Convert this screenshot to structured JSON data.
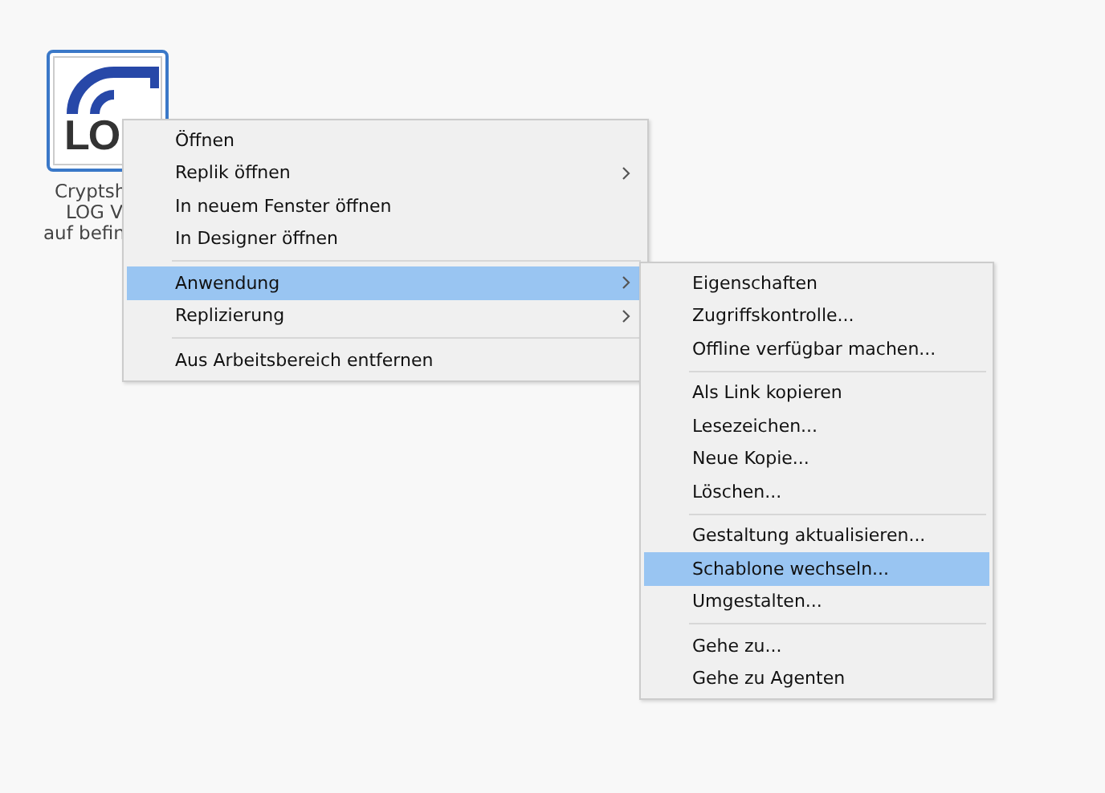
{
  "desktop_icon": {
    "logo_text": "LO",
    "selected": true,
    "label_lines": [
      "Cryptsh",
      "LOG V",
      "auf befin"
    ]
  },
  "context_menu": {
    "items": [
      {
        "kind": "item",
        "label": "Öffnen",
        "selected": false,
        "has_submenu": false
      },
      {
        "kind": "item",
        "label": "Replik öffnen",
        "selected": false,
        "has_submenu": true
      },
      {
        "kind": "item",
        "label": "In neuem Fenster öffnen",
        "selected": false,
        "has_submenu": false
      },
      {
        "kind": "item",
        "label": "In Designer öffnen",
        "selected": false,
        "has_submenu": false
      },
      {
        "kind": "separator"
      },
      {
        "kind": "item",
        "label": "Anwendung",
        "selected": true,
        "has_submenu": true
      },
      {
        "kind": "item",
        "label": "Replizierung",
        "selected": false,
        "has_submenu": true
      },
      {
        "kind": "separator"
      },
      {
        "kind": "item",
        "label": "Aus Arbeitsbereich entfernen",
        "selected": false,
        "has_submenu": false
      }
    ]
  },
  "submenu": {
    "items": [
      {
        "kind": "item",
        "label": "Eigenschaften",
        "selected": false,
        "has_submenu": false
      },
      {
        "kind": "item",
        "label": "Zugriffskontrolle...",
        "selected": false,
        "has_submenu": false
      },
      {
        "kind": "item",
        "label": "Offline verfügbar machen...",
        "selected": false,
        "has_submenu": false
      },
      {
        "kind": "separator"
      },
      {
        "kind": "item",
        "label": "Als Link kopieren",
        "selected": false,
        "has_submenu": false
      },
      {
        "kind": "item",
        "label": "Lesezeichen...",
        "selected": false,
        "has_submenu": false
      },
      {
        "kind": "item",
        "label": "Neue Kopie...",
        "selected": false,
        "has_submenu": false
      },
      {
        "kind": "item",
        "label": "Löschen...",
        "selected": false,
        "has_submenu": false
      },
      {
        "kind": "separator"
      },
      {
        "kind": "item",
        "label": "Gestaltung aktualisieren...",
        "selected": false,
        "has_submenu": false
      },
      {
        "kind": "item",
        "label": "Schablone wechseln...",
        "selected": true,
        "has_submenu": false
      },
      {
        "kind": "item",
        "label": "Umgestalten...",
        "selected": false,
        "has_submenu": false
      },
      {
        "kind": "separator"
      },
      {
        "kind": "item",
        "label": "Gehe zu...",
        "selected": false,
        "has_submenu": false
      },
      {
        "kind": "item",
        "label": "Gehe zu Agenten",
        "selected": false,
        "has_submenu": false
      }
    ]
  }
}
